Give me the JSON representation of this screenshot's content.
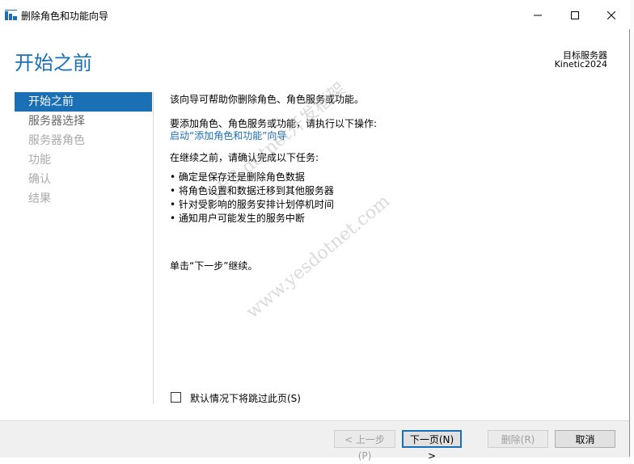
{
  "window": {
    "title": "删除角色和功能向导",
    "icons": {
      "app": "server-manager-icon",
      "minimize": "minimize-icon",
      "maximize": "maximize-icon",
      "close": "close-icon"
    }
  },
  "header": {
    "page_title": "开始之前",
    "target_label": "目标服务器",
    "target_name": "Kinetic2024"
  },
  "nav": {
    "items": [
      {
        "label": "开始之前",
        "state": "active"
      },
      {
        "label": "服务器选择",
        "state": "available"
      },
      {
        "label": "服务器角色",
        "state": "disabled"
      },
      {
        "label": "功能",
        "state": "disabled"
      },
      {
        "label": "确认",
        "state": "disabled"
      },
      {
        "label": "结果",
        "state": "disabled"
      }
    ]
  },
  "content": {
    "intro": "该向导可帮助你删除角色、角色服务或功能。",
    "add_prompt": "要添加角色、角色服务或功能，请执行以下操作:",
    "add_link": "启动“添加角色和功能”向导",
    "before_continue": "在继续之前，请确认完成以下任务:",
    "tasks": [
      "确定是保存还是删除角色数据",
      "将角色设置和数据迁移到其他服务器",
      "针对受影响的服务安排计划停机时间",
      "通知用户可能发生的服务中断"
    ],
    "next_hint": "单击“下一步”继续。"
  },
  "skip": {
    "label": "默认情况下将跳过此页(S)",
    "checked": false
  },
  "footer": {
    "prev": "< 上一步(P)",
    "next": "下一页(N) >",
    "remove": "删除(R)",
    "cancel": "取消"
  },
  "watermark": {
    "line1": "YES dotnet开发框架",
    "line2": "www.yesdotnet.com"
  },
  "colors": {
    "accent": "#1a6fb5"
  }
}
